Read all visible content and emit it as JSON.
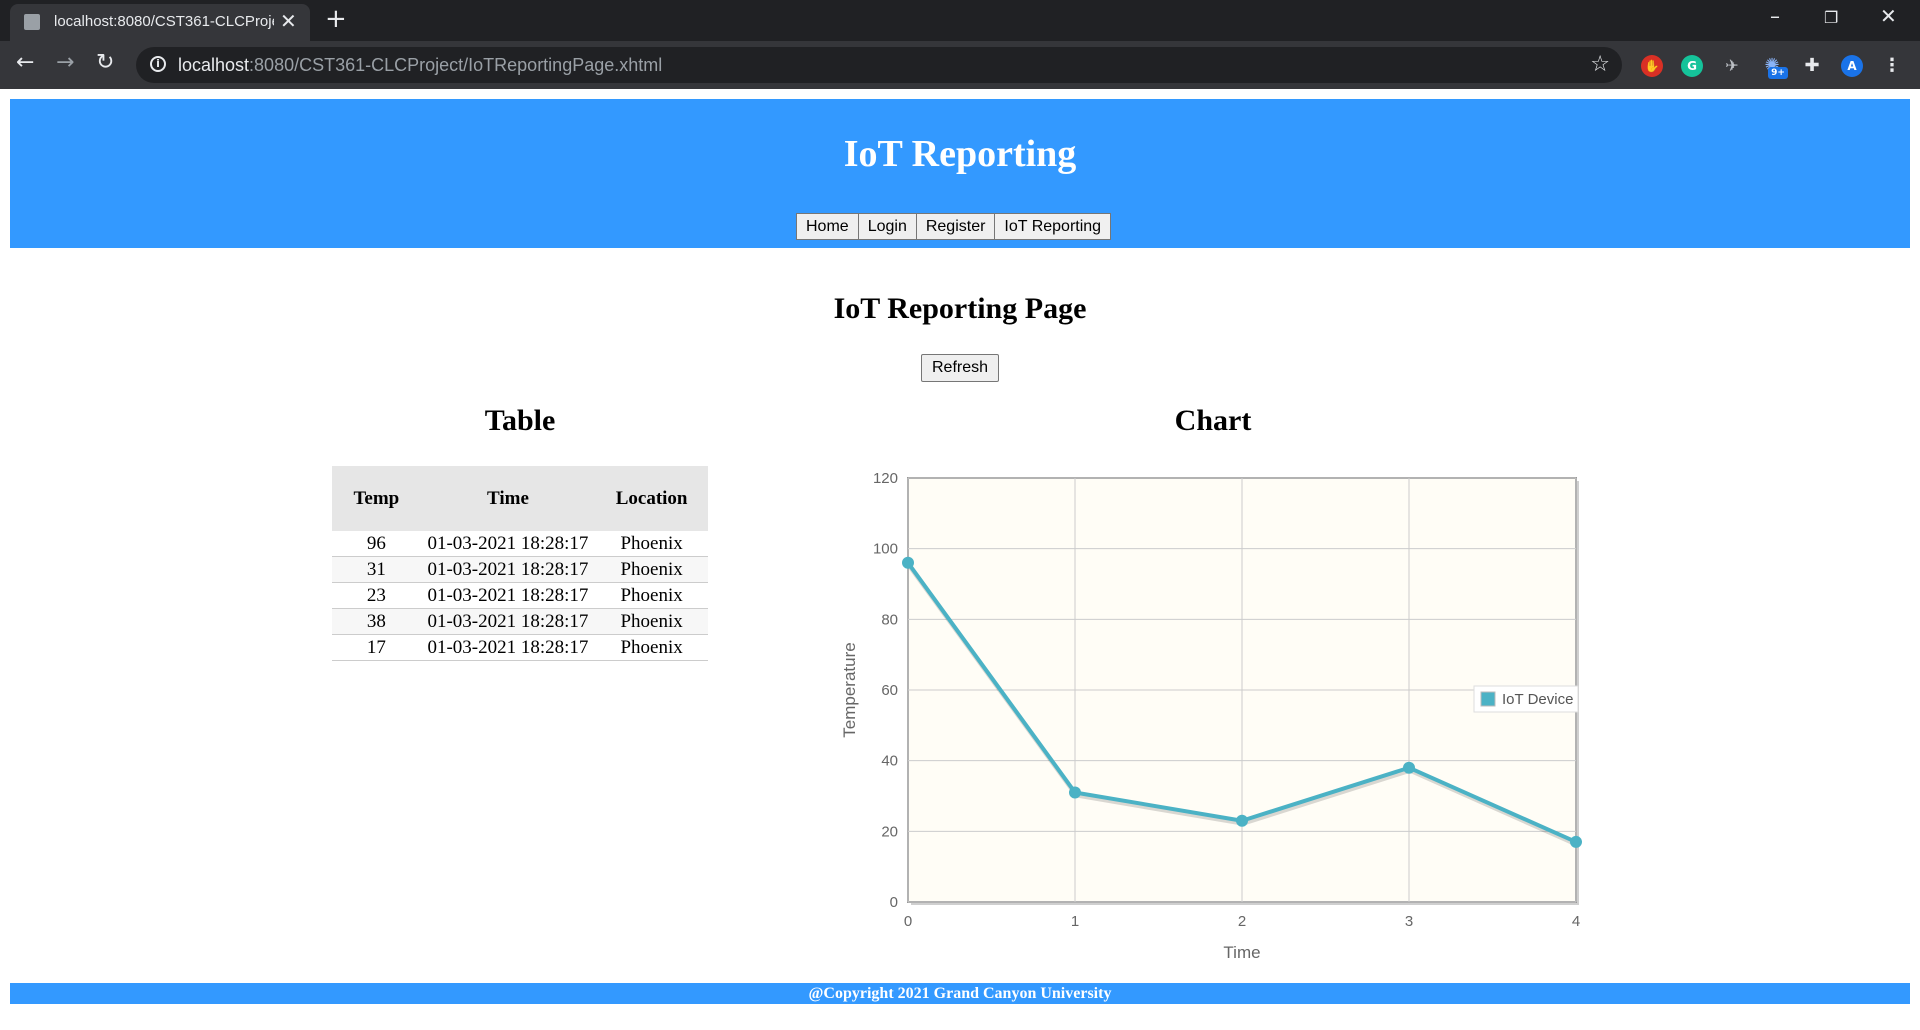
{
  "browser": {
    "tab_title": "localhost:8080/CST361-CLCProje",
    "url_host": "localhost",
    "url_path": ":8080/CST361-CLCProject/IoTReportingPage.xhtml",
    "ext_badge": "9+",
    "profile_initial": "A"
  },
  "header": {
    "title": "IoT Reporting",
    "nav": [
      "Home",
      "Login",
      "Register",
      "IoT Reporting"
    ]
  },
  "main": {
    "title": "IoT Reporting Page",
    "refresh_label": "Refresh",
    "table_heading": "Table",
    "chart_heading": "Chart"
  },
  "table": {
    "columns": [
      "Temp",
      "Time",
      "Location"
    ],
    "rows": [
      [
        "96",
        "01-03-2021 18:28:17",
        "Phoenix"
      ],
      [
        "31",
        "01-03-2021 18:28:17",
        "Phoenix"
      ],
      [
        "23",
        "01-03-2021 18:28:17",
        "Phoenix"
      ],
      [
        "38",
        "01-03-2021 18:28:17",
        "Phoenix"
      ],
      [
        "17",
        "01-03-2021 18:28:17",
        "Phoenix"
      ]
    ]
  },
  "chart_data": {
    "type": "line",
    "xlabel": "Time",
    "ylabel": "Temperature",
    "x": [
      0,
      1,
      2,
      3,
      4
    ],
    "xticks": [
      "0",
      "1",
      "2",
      "3",
      "4"
    ],
    "yticks": [
      "0",
      "20",
      "40",
      "60",
      "80",
      "100",
      "120"
    ],
    "ylim": [
      0,
      120
    ],
    "xlim": [
      0,
      4
    ],
    "series": [
      {
        "name": "IoT Device",
        "values": [
          96,
          31,
          23,
          38,
          17
        ],
        "color": "#4bb2c5"
      }
    ],
    "legend_position": "right",
    "grid": true,
    "background": "#fffdf6"
  },
  "footer": {
    "text": "@Copyright 2021 Grand Canyon University"
  },
  "colors": {
    "brand": "#3399ff",
    "chrome_dark": "#202124",
    "chrome_mid": "#35363a"
  }
}
